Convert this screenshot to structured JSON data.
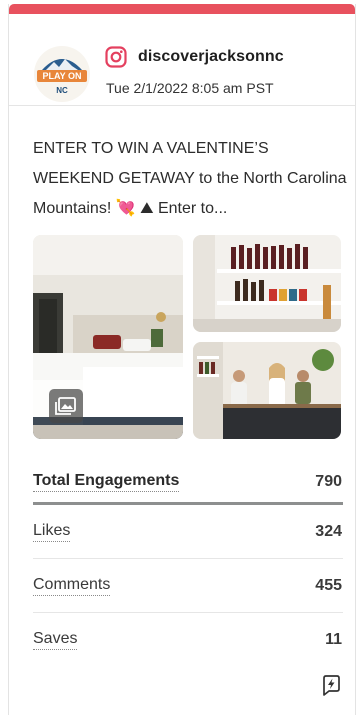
{
  "post": {
    "account_handle": "discoverjacksonnc",
    "timestamp": "Tue 2/1/2022 8:05 am PST",
    "platform_icon": "instagram-icon",
    "avatar_logo_text": {
      "line1": "PLAY ON",
      "line2": "NC"
    },
    "caption": "ENTER TO WIN A VALENTINE’S WEEKEND GETAWAY to the North Carolina Mountains! 💘 ⛰ Enter to...",
    "media": {
      "count_visible": 3,
      "main_badge_icon": "gallery-icon"
    }
  },
  "stats": [
    {
      "label": "Total Engagements",
      "value": "790"
    },
    {
      "label": "Likes",
      "value": "324"
    },
    {
      "label": "Comments",
      "value": "455"
    },
    {
      "label": "Saves",
      "value": "11"
    }
  ],
  "colors": {
    "accent_bar": "#e8515e",
    "instagram": "#e4405f",
    "logo_orange": "#e8863a",
    "logo_navy": "#1e4d7a"
  }
}
